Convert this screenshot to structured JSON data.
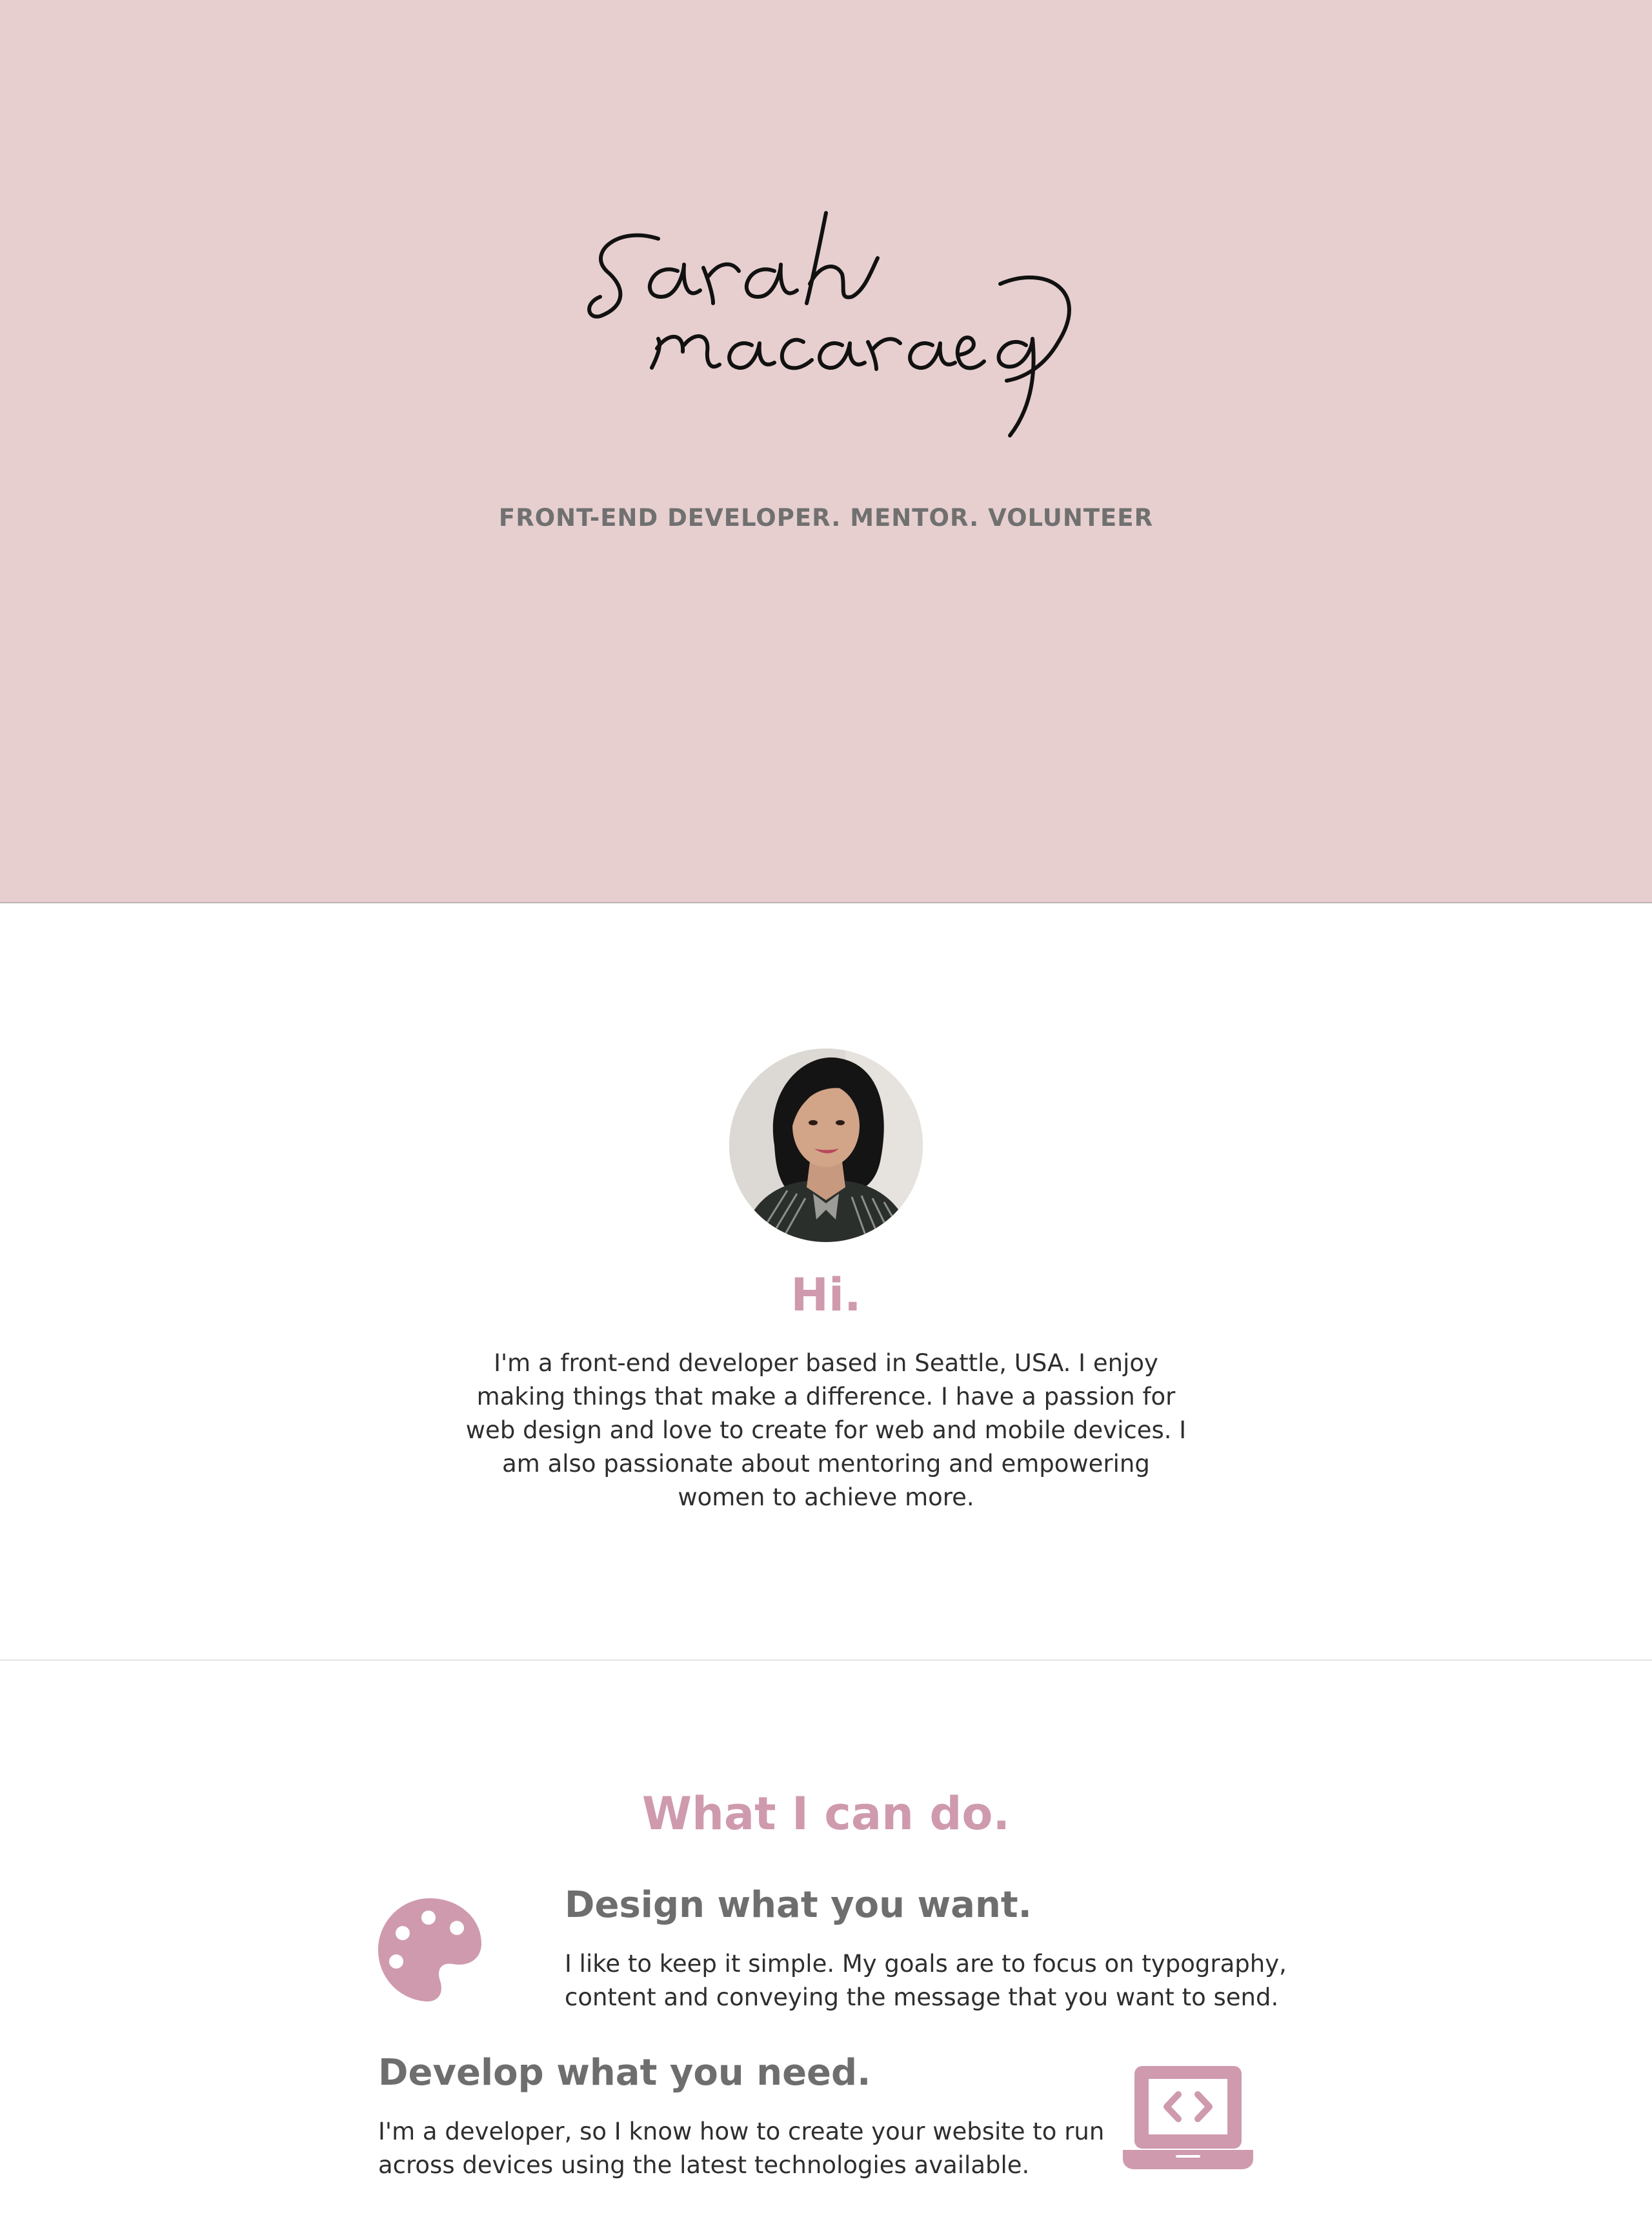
{
  "hero": {
    "signature_name": "sarah macaraeg",
    "tagline": "FRONT-END DEVELOPER. MENTOR. VOLUNTEER"
  },
  "about": {
    "avatar_alt": "Portrait",
    "title": "Hi.",
    "text": "I'm a front-end developer based in Seattle, USA. I enjoy making things that make a difference. I have a passion for web design and love to create for web and mobile devices. I am also passionate about mentoring and empowering women to achieve more."
  },
  "skills": {
    "title": "What I can do.",
    "items": [
      {
        "icon": "palette-icon",
        "heading": "Design what you want.",
        "text": "I like to keep it simple. My goals are to focus on typography, content and conveying the message that you want to send."
      },
      {
        "icon": "laptop-code-icon",
        "heading": "Develop what you need.",
        "text": "I'm a developer, so I know how to create your website to run across devices using the latest technologies available."
      }
    ]
  },
  "colors": {
    "hero_background": "#e7cfcf",
    "accent_pink": "#cf9aae",
    "heading_gray": "#6e6e6e",
    "body_text": "#2e2e2e"
  }
}
